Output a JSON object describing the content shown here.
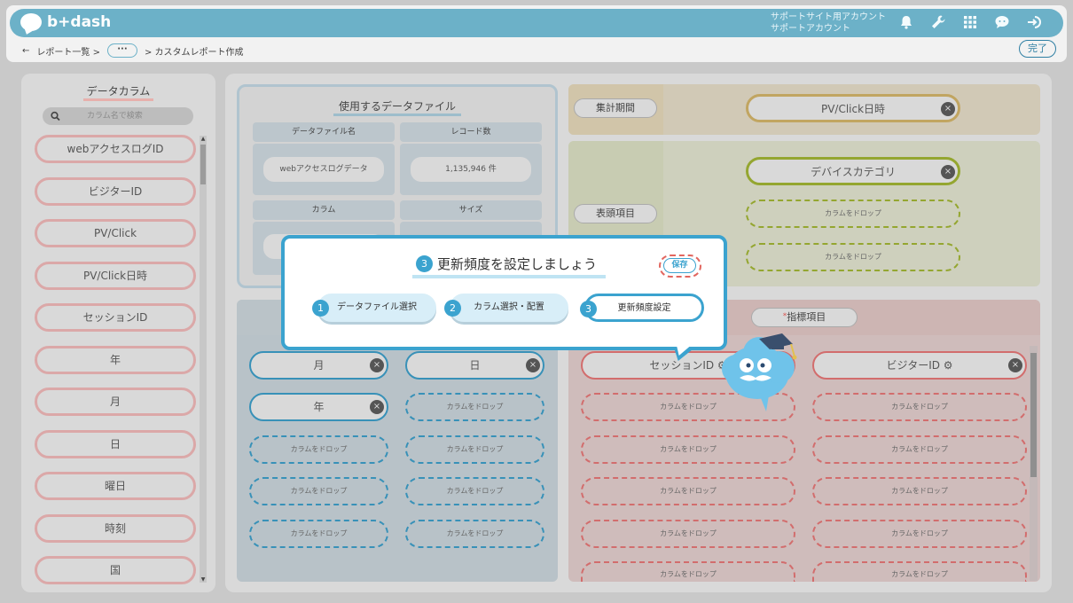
{
  "header": {
    "logo_text": "b+dash",
    "account_line1": "サポートサイト用アカウント",
    "account_line2": "サポートアカウント",
    "icons": [
      "bell-icon",
      "wrench-icon",
      "grid-icon",
      "chat-icon",
      "logout-icon"
    ],
    "bg_color": "#6cb1c8"
  },
  "breadcrumb": {
    "back": "←",
    "report_list": "レポート一覧 >",
    "ellipsis": "···",
    "current": "> カスタムレポート作成"
  },
  "done_button": "完了",
  "sidebar": {
    "title": "データカラム",
    "search_placeholder": "カラム名で検索",
    "items": [
      "webアクセスログID",
      "ビジターID",
      "PV/Click",
      "PV/Click日時",
      "セッションID",
      "年",
      "月",
      "日",
      "曜日",
      "時刻",
      "国"
    ]
  },
  "datafile": {
    "title": "使用するデータファイル",
    "col_file_name": "データファイル名",
    "col_record_count": "レコード数",
    "file_name": "webアクセスログデータ",
    "record_count": "1,135,946 件",
    "col_column": "カラム",
    "col_size": "サイズ"
  },
  "period": {
    "label": "集計期間",
    "chip": "PV/Click日時"
  },
  "header_item": {
    "label": "表頭項目",
    "chip": "デバイスカテゴリ",
    "drop1": "カラムをドロップ",
    "drop2": "カラムをドロップ"
  },
  "metrics": {
    "label": "指標項目",
    "chip1": "セッションID",
    "chip2": "ビジターID",
    "drop": "カラムをドロップ"
  },
  "side_items_area": {
    "chip_month": "月",
    "chip_day": "日",
    "chip_year": "年",
    "drop": "カラムをドロップ"
  },
  "dialog": {
    "step_number": "3",
    "title": "更新頻度を設定しましょう",
    "save": "保存",
    "steps": [
      {
        "num": "1",
        "label": "データファイル選択"
      },
      {
        "num": "2",
        "label": "カラム選択・配置"
      },
      {
        "num": "3",
        "label": "更新頻度設定"
      }
    ]
  },
  "close_glyph": "×",
  "colors": {
    "accent": "#3ba3cf",
    "save_border": "#e2665f",
    "side_item_border": "#dba8a8"
  }
}
